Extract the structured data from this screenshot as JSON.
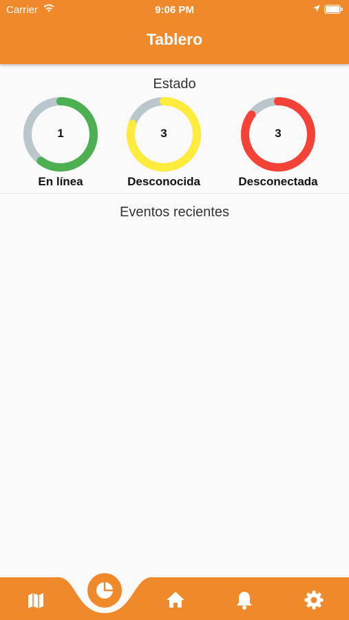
{
  "status_bar": {
    "carrier": "Carrier",
    "time": "9:06 PM"
  },
  "header": {
    "title": "Tablero"
  },
  "estado": {
    "title": "Estado",
    "gauges": [
      {
        "count": "1",
        "label": "En línea",
        "color": "#4caf50",
        "fraction": 0.6
      },
      {
        "count": "3",
        "label": "Desconocida",
        "color": "#ffeb3b",
        "fraction": 0.8
      },
      {
        "count": "3",
        "label": "Desconectada",
        "color": "#f44336",
        "fraction": 0.85
      }
    ]
  },
  "events": {
    "title": "Eventos recientes"
  },
  "colors": {
    "accent": "#f0892a",
    "track": "#b9c7cc"
  },
  "nav": {
    "items": [
      "map-icon",
      "dashboard-icon",
      "home-icon",
      "bell-icon",
      "gear-icon"
    ],
    "selected": "dashboard-icon"
  }
}
